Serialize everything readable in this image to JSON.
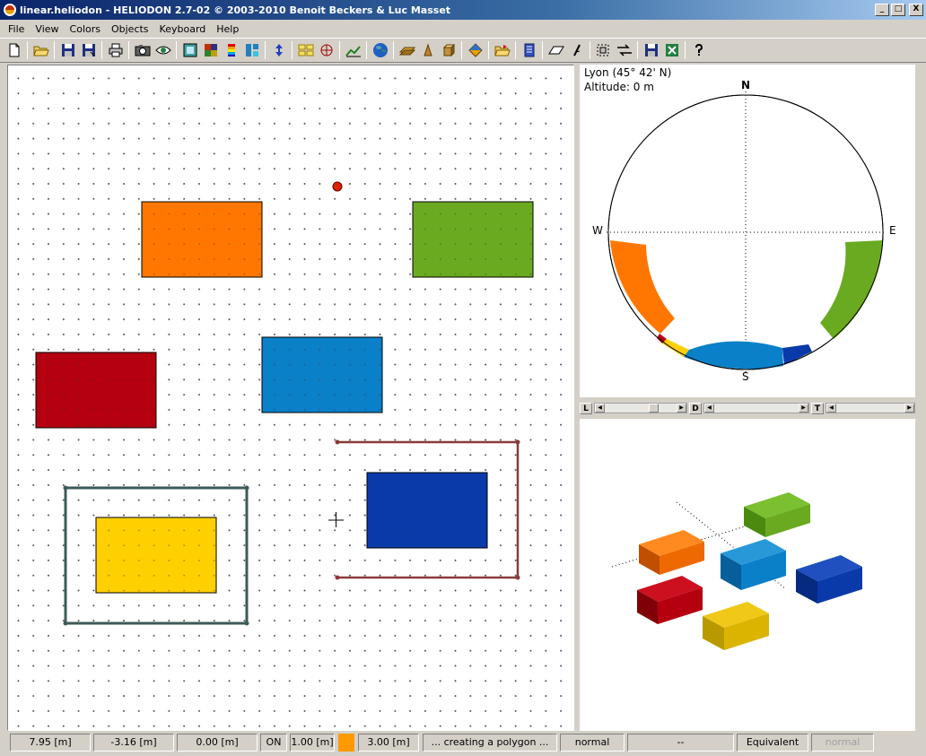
{
  "window": {
    "title": "linear.heliodon  -  HELIODON 2.7-02 © 2003-2010 Benoit Beckers & Luc Masset",
    "minimize_label": "_",
    "maximize_label": "□",
    "close_label": "X"
  },
  "menu": [
    "File",
    "View",
    "Colors",
    "Objects",
    "Keyboard",
    "Help"
  ],
  "toolbar_icons": [
    "new-file-icon",
    "open-folder-icon",
    "save-icon",
    "save-as-icon",
    "print-icon",
    "camera-icon",
    "eye-icon",
    "frame-icon",
    "color-grid-icon",
    "color-scale-icon",
    "tile-view-icon",
    "swap-vertical-icon",
    "grid-view-icon",
    "polar-icon",
    "chart-icon",
    "globe-icon",
    "plane-tool-icon",
    "wedge-tool-icon",
    "box-tool-icon",
    "diamond-icon",
    "folder-open-icon",
    "document-icon",
    "parallelogram-icon",
    "slash-tool-icon",
    "select-icon",
    "arrows-icon",
    "disk-icon",
    "excel-icon",
    "help-icon"
  ],
  "sun_diagram": {
    "location": "Lyon (45° 42' N)",
    "altitude": "Altitude: 0 m",
    "north": "N",
    "south": "S",
    "west": "W",
    "east": "E"
  },
  "sliders": {
    "l_label": "L",
    "d_label": "D",
    "t_label": "T"
  },
  "colors": {
    "orange": "#ff7700",
    "green": "#6aaa20",
    "red": "#b50010",
    "cyan_blue": "#0a80c8",
    "yellow": "#ffd000",
    "navy": "#0a3aaa",
    "sun_dot": "#dd2200",
    "frame_teal": "#3d5a58",
    "polygon_brown": "#8a3a3a"
  },
  "status": {
    "x": "7.95 [m]",
    "y": "-3.16 [m]",
    "z": "0.00 [m]",
    "snap": "ON",
    "grid": "1.00 [m]",
    "height": "3.00 [m]",
    "message": "... creating a polygon ...",
    "mode1": "normal",
    "mode2": "--",
    "mode3": "Equivalent",
    "mode4": "normal"
  }
}
